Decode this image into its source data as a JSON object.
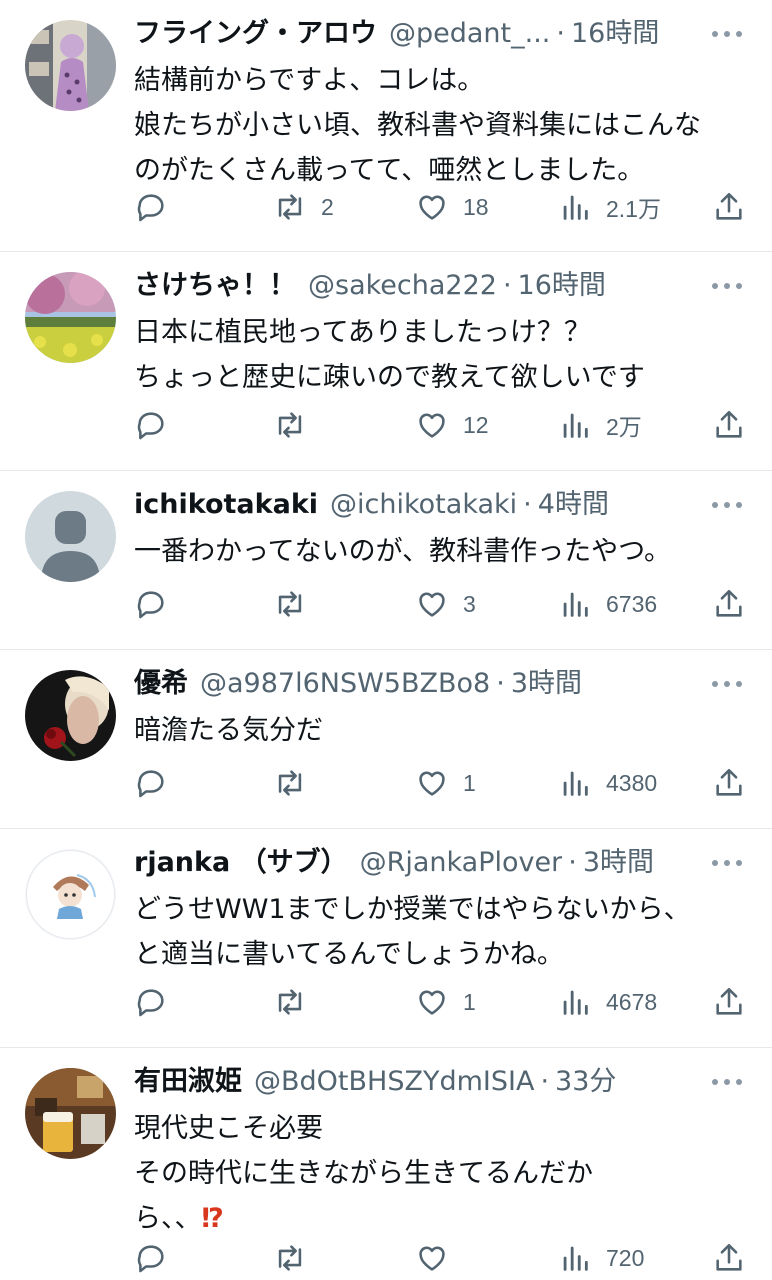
{
  "tweets": [
    {
      "name": "フライング・アロウ",
      "handle": "@pedant_...",
      "time": "16時間",
      "lines": [
        "結構前からですよ、コレは。",
        "娘たちが小さい頃、教科書や資料集にはこんな",
        "のがたくさん載ってて、唖然としました。"
      ],
      "retweets": "2",
      "likes": "18",
      "views": "2.1万",
      "avatar": "illustration-avatar"
    },
    {
      "name": "さけちゃ！！",
      "handle": "@sakecha222",
      "time": "16時間",
      "lines": [
        "日本に植民地ってありましたっけ？？",
        "ちょっと歴史に疎いので教えて欲しいです"
      ],
      "retweets": "",
      "likes": "12",
      "views": "2万",
      "avatar": "flowers-photo-avatar"
    },
    {
      "name": "ichikotakaki",
      "handle": "@ichikotakaki",
      "time": "4時間",
      "lines": [
        "一番わかってないのが、教科書作ったやつ。"
      ],
      "retweets": "",
      "likes": "3",
      "views": "6736",
      "avatar": "default-person-avatar"
    },
    {
      "name": "優希",
      "handle": "@a987l6NSW5BZBo8",
      "time": "3時間",
      "lines": [
        "暗澹たる気分だ"
      ],
      "retweets": "",
      "likes": "1",
      "views": "4380",
      "avatar": "portrait-rose-avatar"
    },
    {
      "name": "rjanka （サブ）",
      "handle": "@RjankaPlover",
      "time": "3時間",
      "lines": [
        "どうせWW1までしか授業ではやらないから、",
        "と適当に書いてるんでしょうかね。"
      ],
      "retweets": "",
      "likes": "1",
      "views": "4678",
      "avatar": "character-avatar"
    },
    {
      "name": "有田淑姫",
      "handle": "@BdOtBHSZYdmISIA",
      "time": "33分",
      "lines": [
        "現代史こそ必要",
        "その時代に生きながら生きてるんだか",
        "ら、、"
      ],
      "emoji_suffix": "⁉",
      "retweets": "",
      "likes": "",
      "views": "720",
      "avatar": "beer-photo-avatar"
    }
  ],
  "colors": {
    "text": "#0f1419",
    "secondary": "#536471",
    "divider": "#e6e9ec",
    "emoji": "#d9361e"
  },
  "icons": [
    "reply-icon",
    "retweet-icon",
    "like-icon",
    "views-icon",
    "share-icon",
    "more-icon"
  ]
}
